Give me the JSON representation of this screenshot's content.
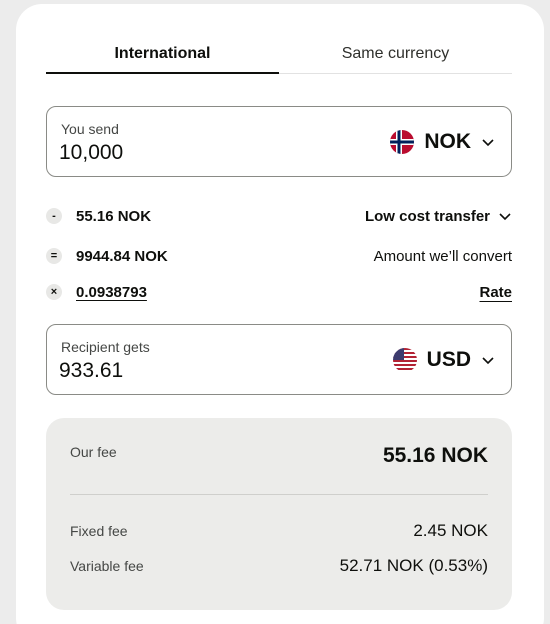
{
  "tabs": [
    {
      "label": "International",
      "active": true
    },
    {
      "label": "Same currency",
      "active": false
    }
  ],
  "send": {
    "label": "You send",
    "value": "10,000",
    "currency": "NOK",
    "flag_icon": "norway-flag-icon"
  },
  "breakdown": {
    "fee": {
      "op": "-",
      "amount": "55.16 NOK",
      "right_label": "Low cost transfer"
    },
    "convert": {
      "op": "=",
      "amount": "9944.84 NOK",
      "right_label": "Amount we’ll convert"
    },
    "rate": {
      "op": "×",
      "amount": "0.0938793",
      "right_label": "Rate"
    }
  },
  "receive": {
    "label": "Recipient gets",
    "value": "933.61",
    "currency": "USD",
    "flag_icon": "usa-flag-icon"
  },
  "fees": {
    "title": "Our fee",
    "total": "55.16 NOK",
    "items": [
      {
        "label": "Fixed fee",
        "value": "2.45 NOK"
      },
      {
        "label": "Variable fee",
        "value": "52.71 NOK (0.53%)"
      }
    ]
  },
  "colors": {
    "text": "#0e0f0c",
    "border": "#8a8b86",
    "fee_bg": "#ececea"
  }
}
